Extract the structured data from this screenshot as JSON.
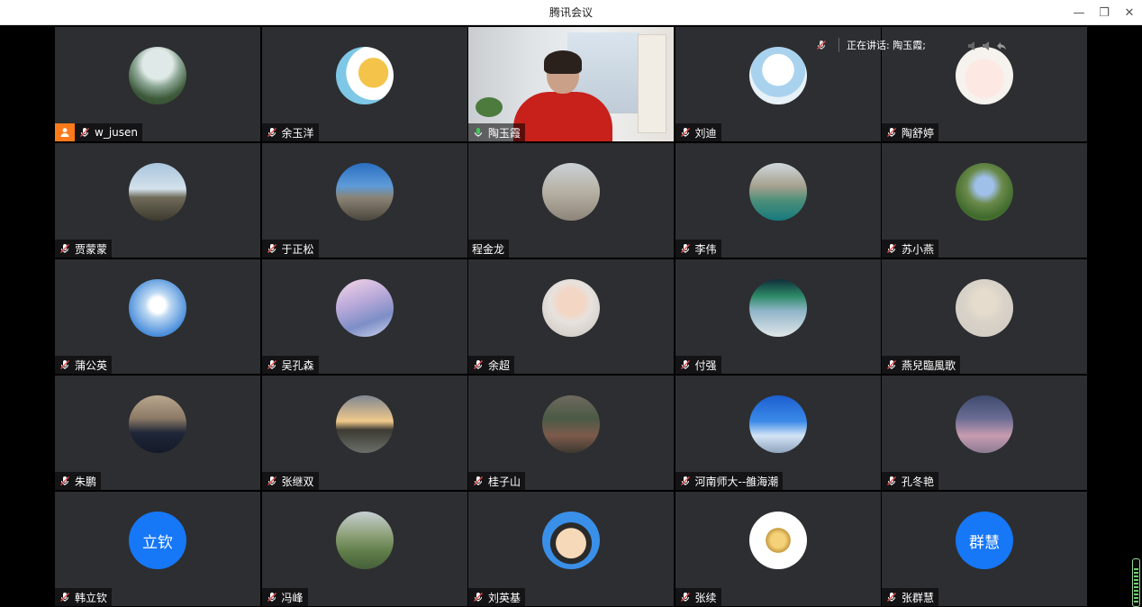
{
  "window": {
    "title": "腾讯会议",
    "minimize": "—",
    "restore": "❐",
    "close": "✕"
  },
  "speaking": {
    "label": "正在讲话: 陶玉霞;"
  },
  "colors": {
    "tile_bg": "#2d2e31",
    "speaking_border": "#3ec957",
    "host_badge": "#ff7a1a",
    "text_avatar_bg": "#1677f7",
    "mic_active": "#3ec957"
  },
  "participants": [
    {
      "name": "w_jusen",
      "host": true,
      "mic": "muted",
      "avatar": {
        "kind": "photo",
        "icon": "lake-tower-photo",
        "bg": "radial-gradient(circle at 50% 30%, #dfe9e7 0 30%, #8ea897 45%, #3d5a3a 70%, #2f4a2c 100%)"
      }
    },
    {
      "name": "余玉洋",
      "mic": "muted",
      "avatar": {
        "kind": "photo",
        "icon": "cartoon-character-avatar",
        "bg": "radial-gradient(circle at 65% 45%, #f4c44a 0 30%, #ffffff 31% 55%, #7ec7e6 56% 100%)"
      }
    },
    {
      "name": "陶玉霞",
      "mic": "active",
      "speaking": true,
      "video": true
    },
    {
      "name": "刘迪",
      "mic": "muted",
      "avatar": {
        "kind": "photo",
        "icon": "cartoon-hat-avatar",
        "bg": "radial-gradient(circle at 50% 40%, #ffffff 0 35%, #a9d2ee 36% 60%, #e7f1f8 61% 100%)"
      }
    },
    {
      "name": "陶舒婷",
      "mic": "muted",
      "avatar": {
        "kind": "photo",
        "icon": "cartoon-cat-avatar",
        "bg": "radial-gradient(circle at 50% 55%, #fde8e4 0 45%, #f6f2ee 46% 100%)"
      }
    },
    {
      "name": "贾蒙蒙",
      "mic": "muted",
      "avatar": {
        "kind": "photo",
        "icon": "riverside-photo",
        "bg": "linear-gradient(180deg, #a9c5de 0%, #d3e1ea 45%, #6f6a59 60%, #3d3a2e 100%)"
      }
    },
    {
      "name": "于正松",
      "mic": "muted",
      "avatar": {
        "kind": "photo",
        "icon": "mountain-tower-photo",
        "bg": "linear-gradient(180deg, #2a6fc2 0%, #5e9bd8 40%, #8a8375 60%, #4b463c 100%)"
      }
    },
    {
      "name": "程金龙",
      "mic": "none",
      "avatar": {
        "kind": "photo",
        "icon": "person-by-rocks-photo",
        "bg": "linear-gradient(180deg, #c9d1d6 0%, #b7b1a4 50%, #8c8478 100%)"
      }
    },
    {
      "name": "李伟",
      "mic": "muted",
      "avatar": {
        "kind": "photo",
        "icon": "lake-cliff-photo",
        "bg": "linear-gradient(180deg, #cfd8dc 0%, #a7a18f 40%, #4c8f7a 65%, #167a7d 100%)"
      }
    },
    {
      "name": "苏小燕",
      "mic": "muted",
      "avatar": {
        "kind": "photo",
        "icon": "trees-photo",
        "bg": "radial-gradient(circle at 50% 40%, #9fc0e8 0 20%, #6a8a4a 40%, #3f6a2c 70%, #5d8f3c 100%)"
      }
    },
    {
      "name": "蒲公英",
      "mic": "muted",
      "avatar": {
        "kind": "photo",
        "icon": "dandelion-photo",
        "bg": "radial-gradient(circle at 50% 45%, #ffffff 0 18%, #bcd8f2 30%, #4c8fdb 70%, #2f6fc6 100%)"
      }
    },
    {
      "name": "吴孔森",
      "mic": "muted",
      "avatar": {
        "kind": "photo",
        "icon": "anime-street-photo",
        "bg": "linear-gradient(160deg, #f4d6e8 0%, #b9a9d9 40%, #7d8ec7 70%, #cfd7ec 100%)"
      }
    },
    {
      "name": "余超",
      "mic": "muted",
      "avatar": {
        "kind": "photo",
        "icon": "child-photo",
        "bg": "radial-gradient(circle at 50% 40%, #f3d6c4 0 28%, #e7e2de 45%, #c9c2bc 100%)"
      }
    },
    {
      "name": "付强",
      "mic": "muted",
      "avatar": {
        "kind": "photo",
        "icon": "aurora-photo",
        "bg": "linear-gradient(180deg, #0f2e3a 0%, #2f8c6a 30%, #8fb4c8 55%, #e2e7ea 100%)"
      }
    },
    {
      "name": "燕兒臨風歌",
      "mic": "muted",
      "avatar": {
        "kind": "photo",
        "icon": "girl-illustration",
        "bg": "radial-gradient(circle at 50% 40%, #e6dccd 0 25%, #d8d2c8 45%, #cfcac2 100%)"
      }
    },
    {
      "name": "朱鹏",
      "mic": "muted",
      "avatar": {
        "kind": "photo",
        "icon": "man-in-suit-photo",
        "bg": "linear-gradient(180deg, #b9a68e 0%, #8c7a66 40%, #1e2638 65%, #141a28 100%)"
      }
    },
    {
      "name": "张继双",
      "mic": "muted",
      "avatar": {
        "kind": "photo",
        "icon": "sunset-lake-photo",
        "bg": "linear-gradient(180deg, #7f8792 0%, #f0c98a 45%, #3c3b33 60%, #6b6f6a 100%)"
      }
    },
    {
      "name": "桂子山",
      "mic": "muted",
      "avatar": {
        "kind": "photo",
        "icon": "forest-photo",
        "bg": "linear-gradient(180deg, #6f6a60 0%, #4b5a45 40%, #7d5a4b 70%, #3c3930 100%)"
      }
    },
    {
      "name": "河南师大--雒海潮",
      "mic": "muted",
      "avatar": {
        "kind": "photo",
        "icon": "blue-sky-building-photo",
        "bg": "linear-gradient(180deg, #1c5fd0 0%, #3b8ae8 45%, #d3e4f5 70%, #8fa4bd 100%)"
      }
    },
    {
      "name": "孔冬艳",
      "mic": "muted",
      "avatar": {
        "kind": "photo",
        "icon": "dusk-sky-photo",
        "bg": "linear-gradient(180deg, #3e4a6e 0%, #6a6c93 40%, #c79cb0 70%, #8c7b93 100%)"
      }
    },
    {
      "name": "韩立钦",
      "mic": "muted",
      "avatar": {
        "kind": "text",
        "text": "立钦"
      }
    },
    {
      "name": "冯峰",
      "mic": "muted",
      "avatar": {
        "kind": "photo",
        "icon": "willow-trees-photo",
        "bg": "linear-gradient(180deg, #c6cfd3 0%, #8fa27a 40%, #5f7d49 70%, #46603a 100%)"
      }
    },
    {
      "name": "刘英基",
      "mic": "muted",
      "avatar": {
        "kind": "photo",
        "icon": "cartoon-man-glasses-avatar",
        "bg": "radial-gradient(circle at 50% 55%, #f6d9b9 0 35%, #2a2a2a 36% 48%, #3a8fe8 49% 100%)"
      }
    },
    {
      "name": "张续",
      "mic": "muted",
      "avatar": {
        "kind": "photo",
        "icon": "gold-star-logo",
        "bg": "radial-gradient(circle at 50% 50%, #f4d27a 0 18%, #c79a3c 30%, #ffffff 31% 100%)"
      }
    },
    {
      "name": "张群慧",
      "mic": "muted",
      "avatar": {
        "kind": "text",
        "text": "群慧"
      }
    }
  ]
}
